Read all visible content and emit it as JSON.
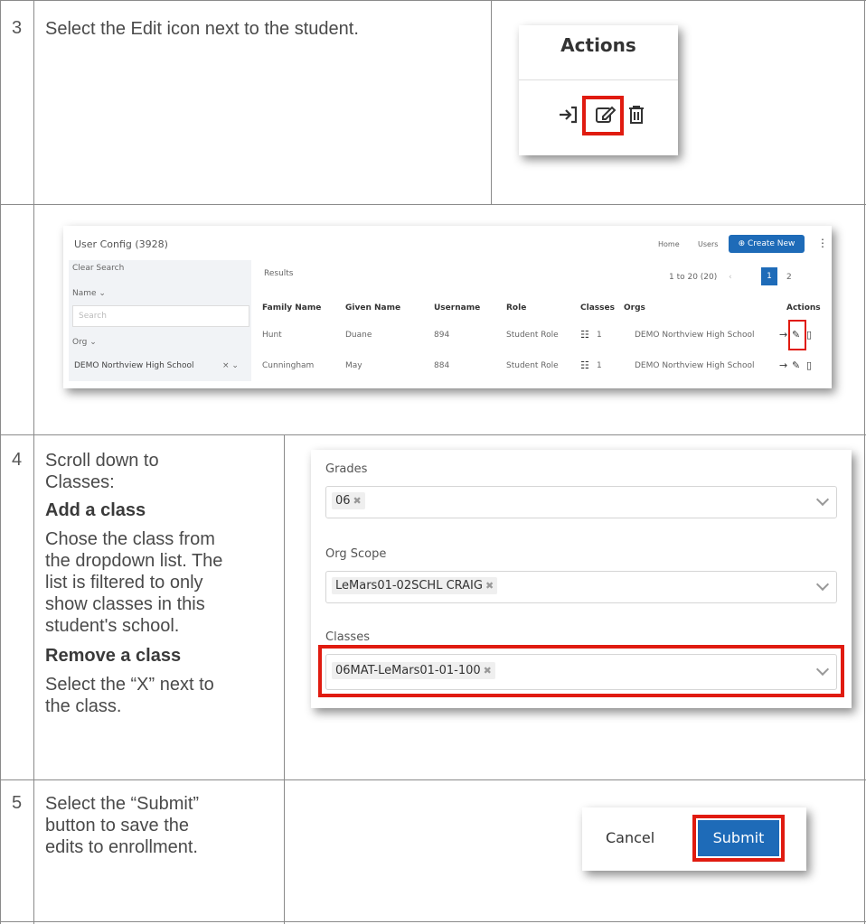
{
  "steps": [
    {
      "num": "3",
      "text": "Select the Edit icon next to the student."
    },
    {
      "num": "4",
      "lines": [
        "Scroll down to",
        "Classes:"
      ],
      "add_heading": "Add a class",
      "add_body": [
        "Chose the class from",
        "the dropdown list. The",
        "list is filtered to only",
        "show classes in this",
        "student's school."
      ],
      "remove_heading": "Remove a class",
      "remove_body": [
        "Select the “X” next to",
        "the class."
      ]
    },
    {
      "num": "5",
      "lines": [
        "Select the “Submit”",
        "button to save the",
        "edits to enrollment."
      ]
    }
  ],
  "actions_panel": {
    "header": "Actions",
    "icons": [
      "login-arrow-icon",
      "edit-icon",
      "trash-icon"
    ]
  },
  "user_config": {
    "title": "User Config (3928)",
    "breadcrumb": [
      "Home",
      "Users"
    ],
    "create_button": "Create New",
    "sidebar": {
      "clear_search": "Clear Search",
      "name_filter": "Name",
      "search_placeholder": "Search",
      "org_filter": "Org",
      "org_value": "DEMO Northview High School"
    },
    "results_label": "Results",
    "pager_text": "1 to 20 (20)",
    "pages": [
      "1",
      "2"
    ],
    "columns": [
      "Family Name",
      "Given Name",
      "Username",
      "Role",
      "Classes",
      "Orgs",
      "Actions"
    ],
    "rows": [
      {
        "family": "Hunt",
        "given": "Duane",
        "username": "894",
        "role": "Student Role",
        "classes": "1",
        "orgs": "DEMO Northview High School"
      },
      {
        "family": "Cunningham",
        "given": "May",
        "username": "884",
        "role": "Student Role",
        "classes": "1",
        "orgs": "DEMO Northview High School"
      }
    ]
  },
  "edit_form": {
    "grades_label": "Grades",
    "grades_value": "06",
    "org_scope_label": "Org Scope",
    "org_scope_value": "LeMars01-02SCHL CRAIG",
    "classes_label": "Classes",
    "classes_value": "06MAT-LeMars01-01-100"
  },
  "buttons": {
    "cancel": "Cancel",
    "submit": "Submit"
  },
  "colors": {
    "highlight": "#e01b10",
    "primary": "#1e6bb8"
  }
}
